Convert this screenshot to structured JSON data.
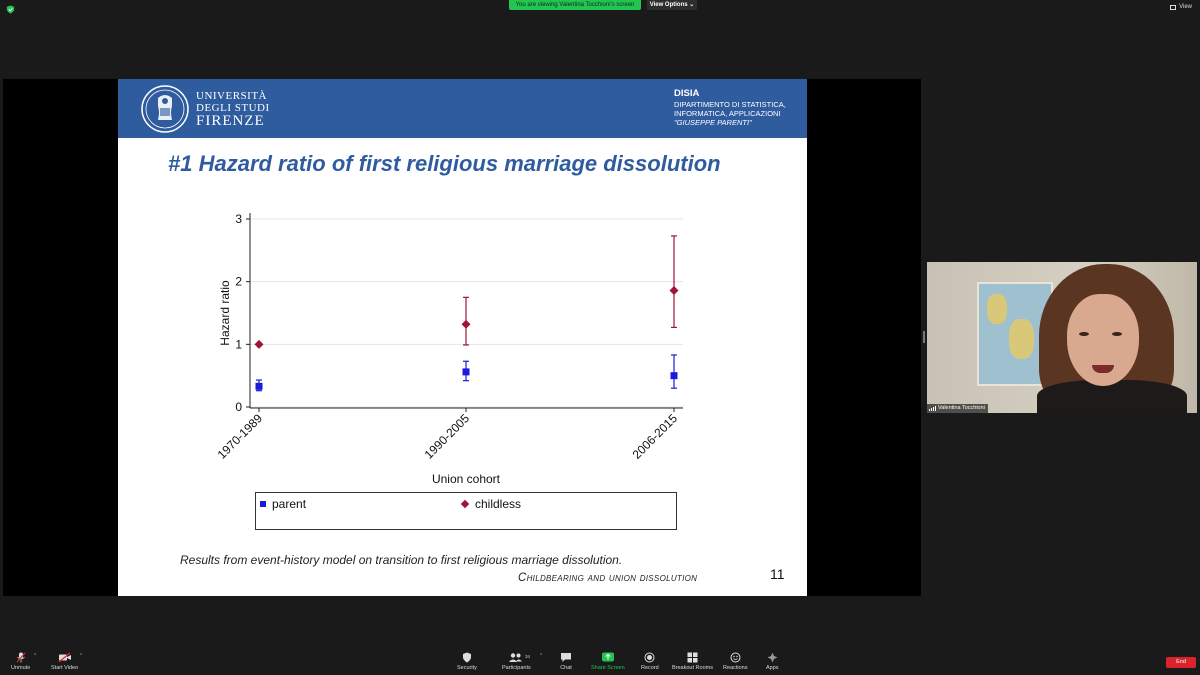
{
  "topbar": {
    "viewing_text": "You are viewing Valentina Tocchioni's screen",
    "view_options_label": "View Options",
    "view_label": "View"
  },
  "slide": {
    "university": {
      "line1": "UNIVERSITÀ",
      "line2": "DEGLI STUDI",
      "line3": "FIRENZE"
    },
    "department": {
      "name": "DISIA",
      "line1": "DIPARTIMENTO DI STATISTICA,",
      "line2": "INFORMATICA, APPLICAZIONI",
      "line3": "\"GIUSEPPE PARENTI\""
    },
    "title": "#1 Hazard ratio of first religious marriage dissolution",
    "caption": "Results from event-history model on transition to first religious marriage dissolution.",
    "footer": "Childbearing and union dissolution",
    "page_number": "11",
    "header_color": "#2f5b9f"
  },
  "chart_data": {
    "type": "scatter",
    "xlabel": "Union cohort",
    "ylabel": "Hazard ratio",
    "categories": [
      "1970-1989",
      "1990-2005",
      "2006-2015"
    ],
    "ylim": [
      0,
      3
    ],
    "yticks": [
      "0",
      "1",
      "2",
      "3"
    ],
    "grid": true,
    "legend_position": "bottom",
    "series": [
      {
        "name": "parent",
        "marker": "square",
        "color": "#1a1adb",
        "values": [
          0.33,
          0.56,
          0.5
        ],
        "ci_low": [
          0.26,
          0.42,
          0.3
        ],
        "ci_high": [
          0.43,
          0.73,
          0.83
        ]
      },
      {
        "name": "childless",
        "marker": "diamond",
        "color": "#a0143a",
        "values": [
          1.0,
          1.32,
          1.86
        ],
        "ci_low": [
          null,
          0.99,
          1.27
        ],
        "ci_high": [
          null,
          1.75,
          2.73
        ]
      }
    ]
  },
  "participant": {
    "name": "Valentina Tocchioni"
  },
  "toolbar": {
    "unmute": "Unmute",
    "start_video": "Start Video",
    "security": "Security",
    "participants": "Participants",
    "participants_count": "34",
    "chat": "Chat",
    "share_screen": "Share Screen",
    "record": "Record",
    "breakout_rooms": "Breakout Rooms",
    "reactions": "Reactions",
    "apps": "Apps",
    "end": "End"
  }
}
